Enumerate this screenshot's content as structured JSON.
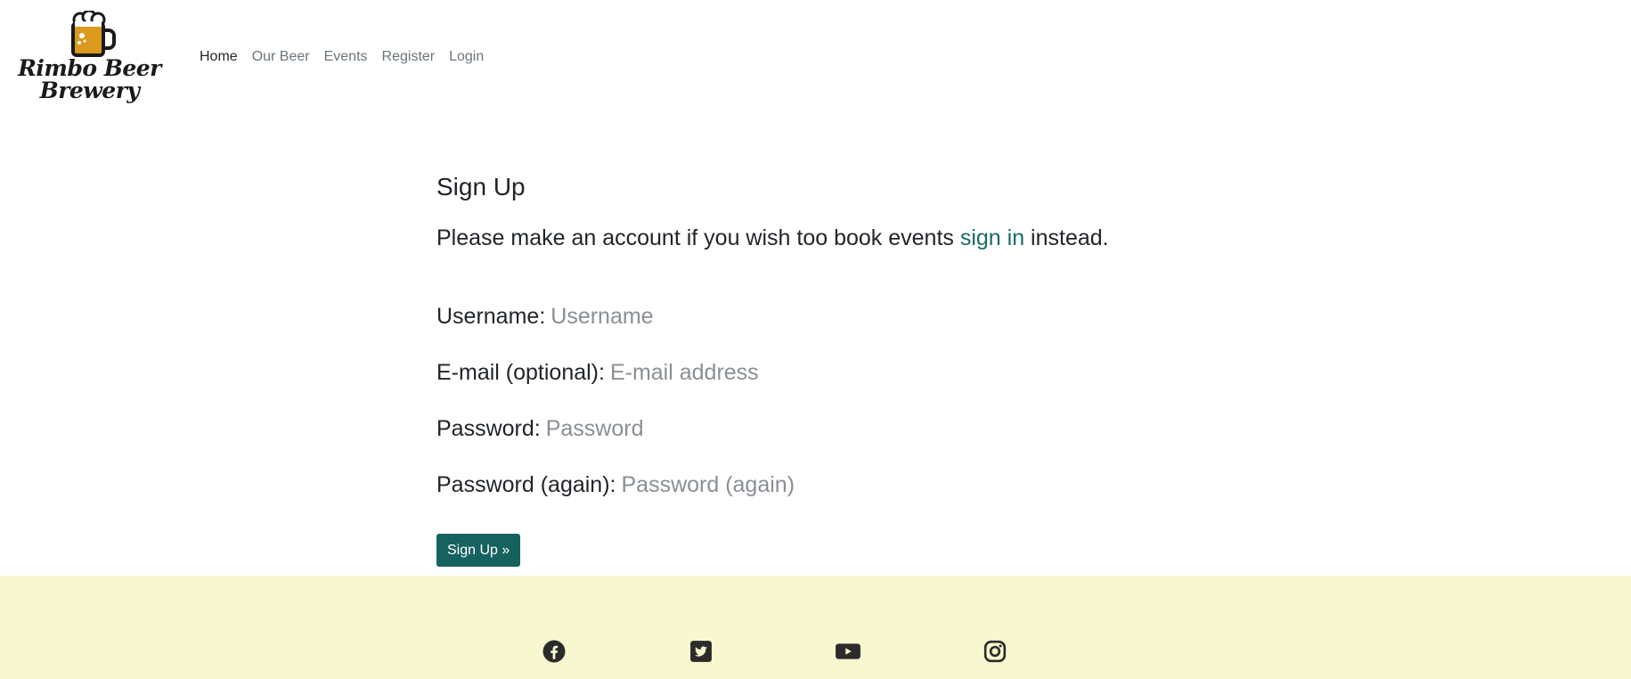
{
  "brand": {
    "name_line1": "Rimbo Beer",
    "name_line2": "Brewery",
    "logo_icon": "beer-mug-icon",
    "mug_color": "#d99a1e"
  },
  "nav": {
    "items": [
      {
        "label": "Home",
        "active": true
      },
      {
        "label": "Our Beer",
        "active": false
      },
      {
        "label": "Events",
        "active": false
      },
      {
        "label": "Register",
        "active": false
      },
      {
        "label": "Login",
        "active": false
      }
    ]
  },
  "signup": {
    "title": "Sign Up",
    "intro_prefix": "Please make an account if you wish too book events ",
    "intro_link": "sign in",
    "intro_suffix": " instead.",
    "fields": [
      {
        "label": "Username:",
        "placeholder": "Username"
      },
      {
        "label": "E-mail (optional):",
        "placeholder": "E-mail address"
      },
      {
        "label": "Password:",
        "placeholder": "Password"
      },
      {
        "label": "Password (again):",
        "placeholder": "Password (again)"
      }
    ],
    "submit_label": "Sign Up »"
  },
  "footer": {
    "background": "#f8f8d0",
    "social": [
      {
        "icon": "facebook-icon"
      },
      {
        "icon": "twitter-icon"
      },
      {
        "icon": "youtube-icon"
      },
      {
        "icon": "instagram-icon"
      }
    ]
  },
  "colors": {
    "accent": "#15625f",
    "link": "#1b6b69"
  }
}
